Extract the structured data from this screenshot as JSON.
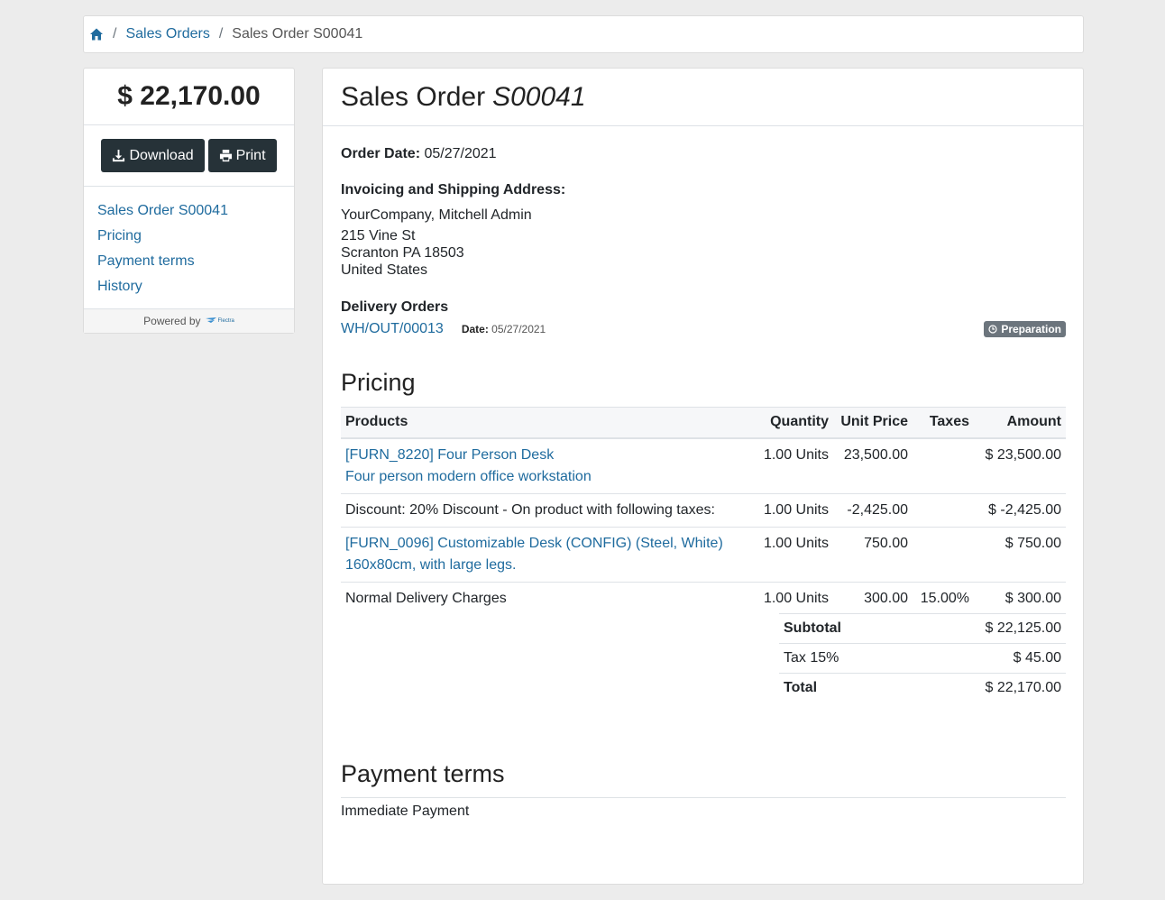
{
  "breadcrumb": {
    "home_icon": "home-icon",
    "sales_orders": "Sales Orders",
    "current": "Sales Order S00041"
  },
  "sidebar": {
    "total": "$ 22,170.00",
    "download_label": "Download",
    "print_label": "Print",
    "nav": [
      "Sales Order S00041",
      "Pricing",
      "Payment terms",
      "History"
    ],
    "powered_by": "Powered by",
    "powered_logo_text": "Flectra"
  },
  "order": {
    "title_prefix": "Sales Order",
    "title_ref": "S00041",
    "order_date_label": "Order Date:",
    "order_date": "05/27/2021",
    "address_title": "Invoicing and Shipping Address:",
    "address_name": "YourCompany, Mitchell Admin",
    "address_line1": "215 Vine St",
    "address_line2": "Scranton PA 18503",
    "address_line3": "United States",
    "delivery_title": "Delivery Orders",
    "delivery_ref": "WH/OUT/00013",
    "delivery_date_label": "Date:",
    "delivery_date": "05/27/2021",
    "delivery_status": "Preparation"
  },
  "pricing": {
    "title": "Pricing",
    "columns": {
      "products": "Products",
      "quantity": "Quantity",
      "unit_price": "Unit Price",
      "taxes": "Taxes",
      "amount": "Amount"
    },
    "rows": [
      {
        "name": "[FURN_8220] Four Person Desk",
        "desc": "Four person modern office workstation",
        "qty": "1.00 Units",
        "price": "23,500.00",
        "taxes": "",
        "amount": "$ 23,500.00"
      },
      {
        "name": "Discount: 20% Discount - On product with following taxes:",
        "desc": "",
        "qty": "1.00 Units",
        "price": "-2,425.00",
        "taxes": "",
        "amount": "$ -2,425.00"
      },
      {
        "name": "[FURN_0096] Customizable Desk (CONFIG) (Steel, White)",
        "desc": "160x80cm, with large legs.",
        "qty": "1.00 Units",
        "price": "750.00",
        "taxes": "",
        "amount": "$ 750.00"
      },
      {
        "name": "Normal Delivery Charges",
        "desc": "",
        "qty": "1.00 Units",
        "price": "300.00",
        "taxes": "15.00%",
        "amount": "$ 300.00"
      }
    ],
    "subtotal_label": "Subtotal",
    "subtotal": "$ 22,125.00",
    "tax_label": "Tax 15%",
    "tax": "$ 45.00",
    "total_label": "Total",
    "total": "$ 22,170.00"
  },
  "payment": {
    "title": "Payment terms",
    "value": "Immediate Payment"
  },
  "colors": {
    "link": "#1f6b9e",
    "button_dark": "#263238",
    "badge": "#6c757d",
    "background": "#ececec"
  }
}
